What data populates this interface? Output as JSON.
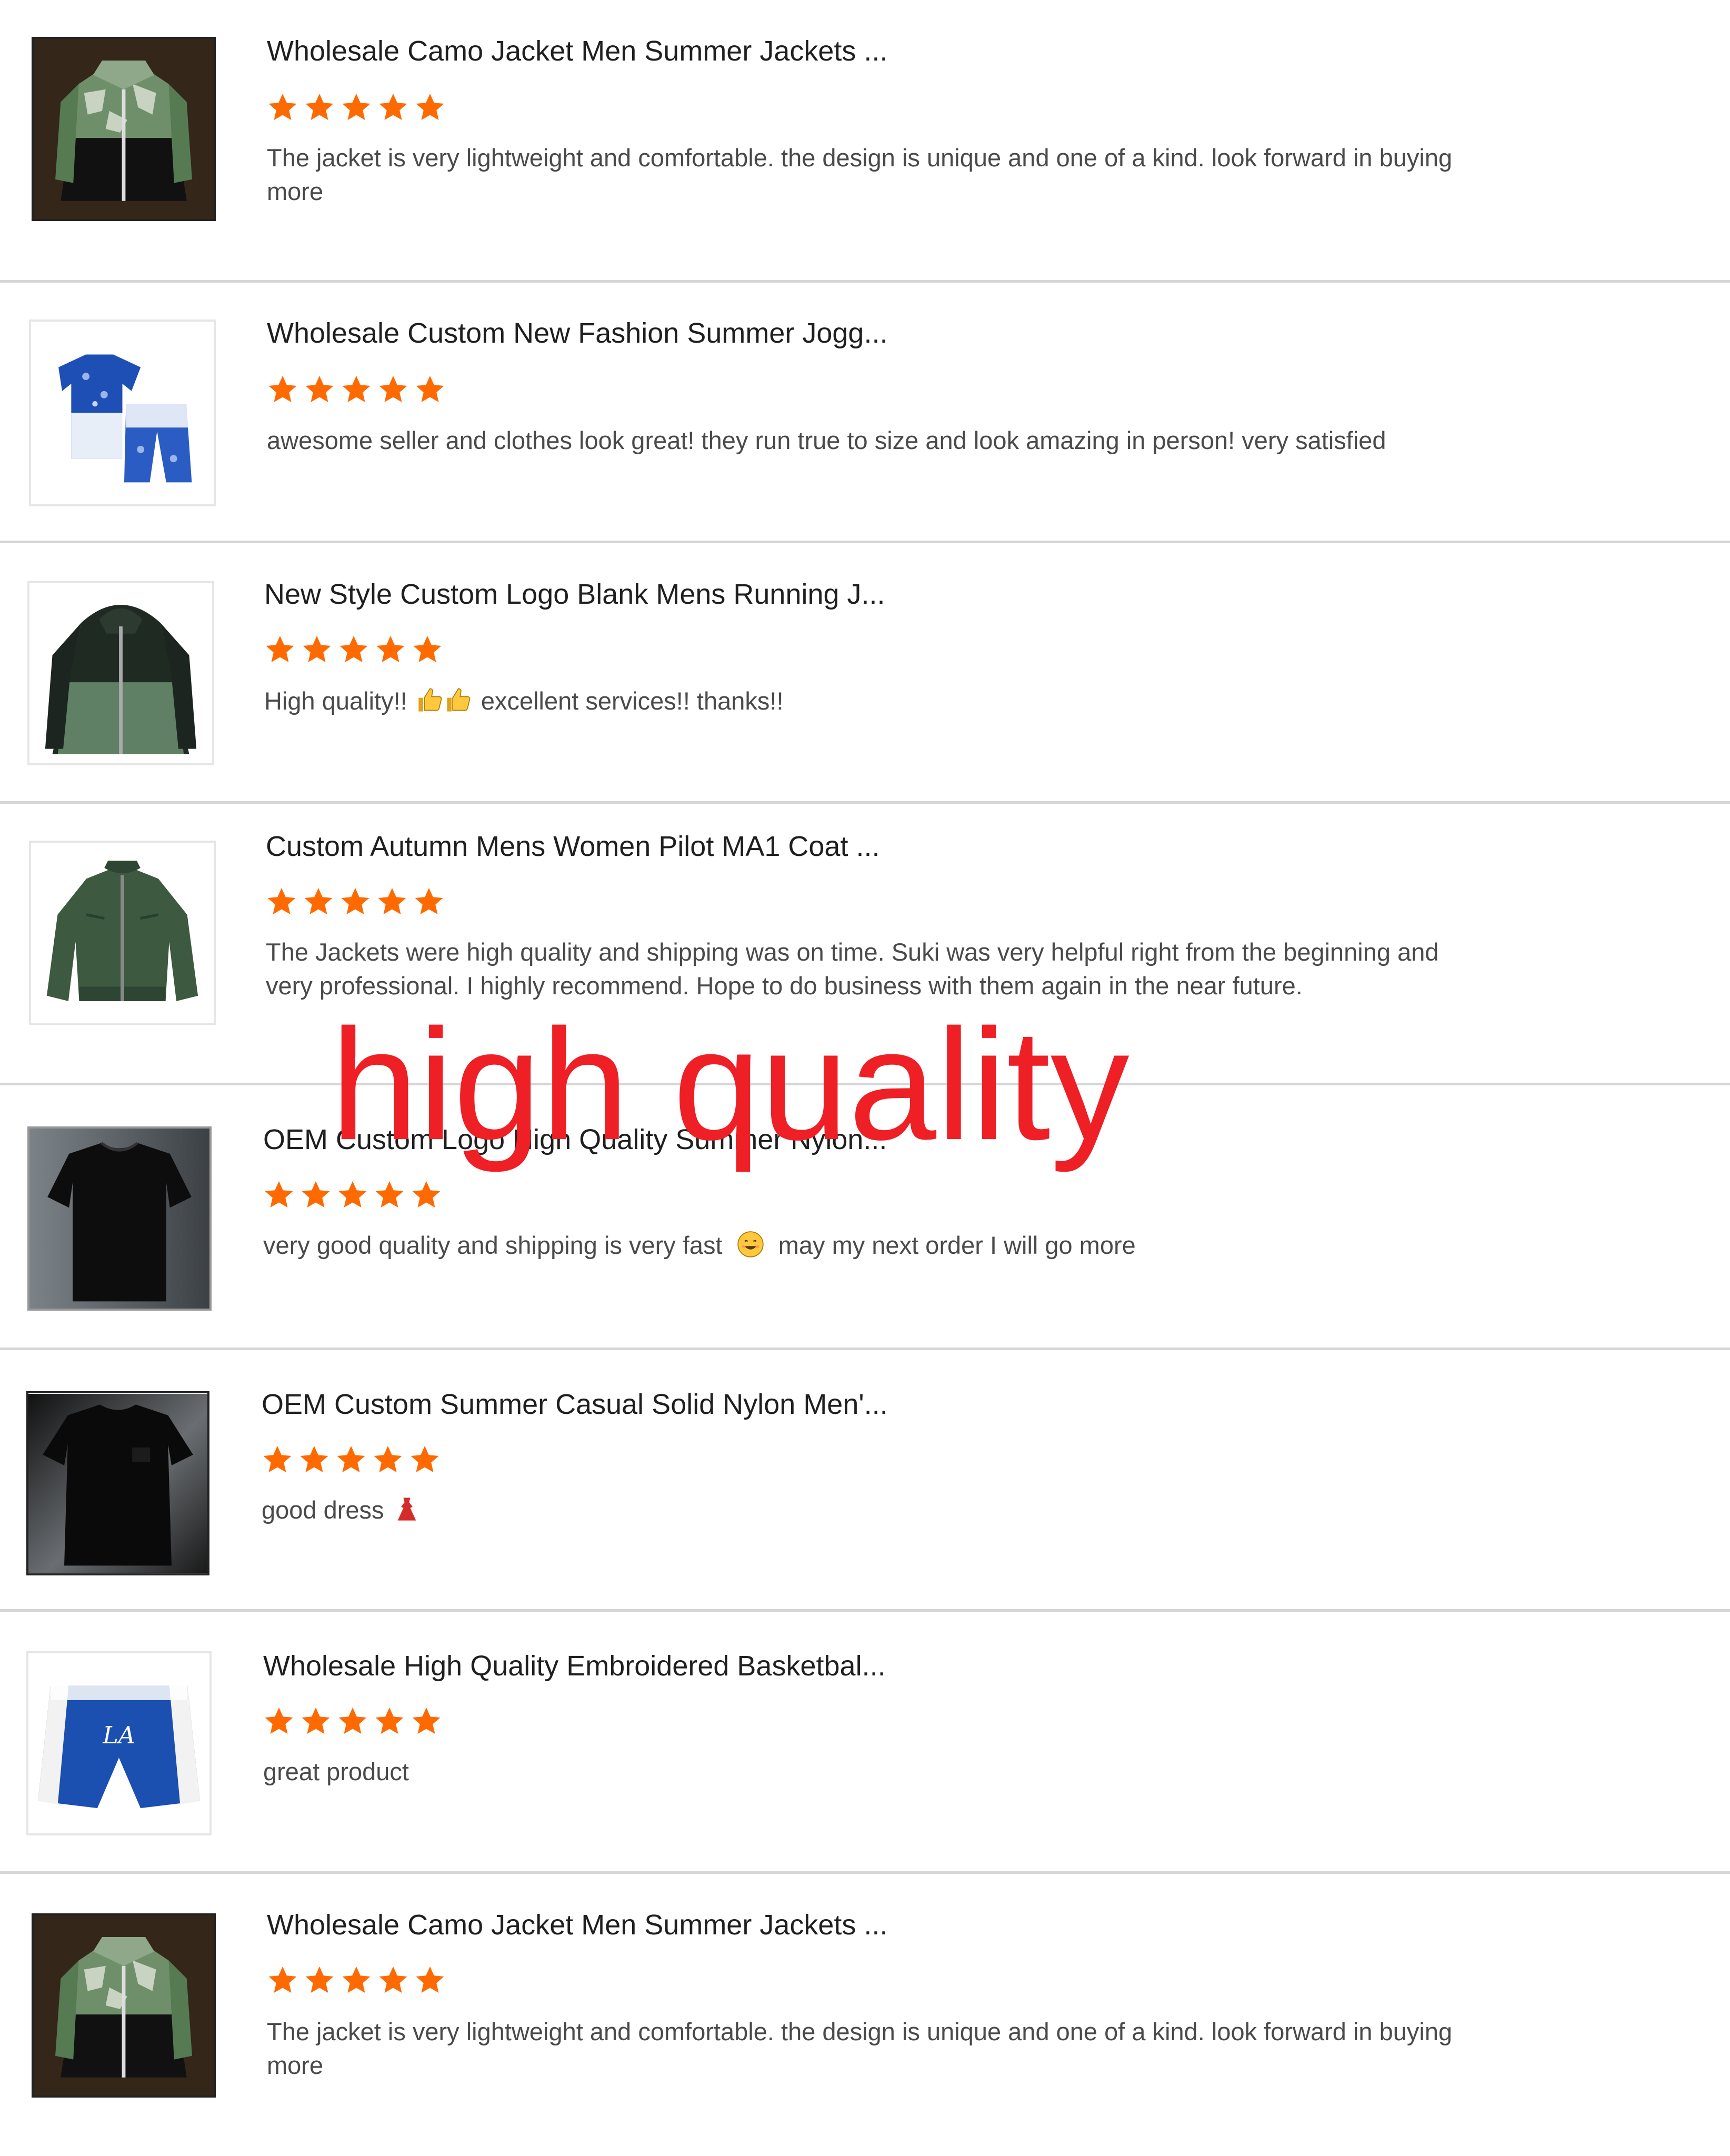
{
  "colors": {
    "star": "#ff6a00",
    "overlay_text": "#ee1f25",
    "divider": "#d6d6d6"
  },
  "overlay": {
    "text": "high quality"
  },
  "reviews": [
    {
      "title": "Wholesale Camo Jacket Men Summer Jackets ...",
      "rating": 5,
      "text": "The jacket is very lightweight and comfortable. the design is unique and one of a kind. look forward in buying more",
      "thumbnail": "camo-jacket-image"
    },
    {
      "title": "Wholesale Custom New Fashion Summer Jogg...",
      "rating": 5,
      "text": "awesome seller and clothes look great! they run true to size and look amazing in person! very satisfied",
      "thumbnail": "blue-tshirt-shorts-set-image"
    },
    {
      "title": "New Style Custom Logo Blank Mens Running J...",
      "rating": 5,
      "text_before": "High quality!!",
      "text_after": "excellent services!! thanks!!",
      "emojis": [
        "thumbs-up-icon",
        "thumbs-up-icon"
      ],
      "thumbnail": "green-running-jacket-image"
    },
    {
      "title": "Custom Autumn Mens Women Pilot MA1 Coat ...",
      "rating": 5,
      "text": "The Jackets were high quality and shipping was on time. Suki was very helpful right from the beginning and very professional. I highly recommend. Hope to do business with them again in the near future.",
      "thumbnail": "green-bomber-jacket-image"
    },
    {
      "title": "OEM Custom Logo High Quality Summer Nylon...",
      "rating": 5,
      "text_before": "very good quality and shipping is very fast",
      "text_after": "may my next order I will go more",
      "emojis": [
        "smiling-face-icon"
      ],
      "thumbnail": "black-tshirt-image"
    },
    {
      "title": "OEM Custom Summer Casual Solid Nylon Men'...",
      "rating": 5,
      "text_before": "good dress",
      "text_after": "",
      "emojis": [
        "dress-icon"
      ],
      "thumbnail": "black-tshirt-dark-image"
    },
    {
      "title": "Wholesale High Quality Embroidered Basketbal...",
      "rating": 5,
      "text": "great product",
      "thumbnail": "basketball-shorts-image"
    },
    {
      "title": "Wholesale Camo Jacket Men Summer Jackets ...",
      "rating": 5,
      "text": "The jacket is very lightweight and comfortable. the design is unique and one of a kind. look forward in buying more",
      "thumbnail": "camo-jacket-image"
    }
  ]
}
